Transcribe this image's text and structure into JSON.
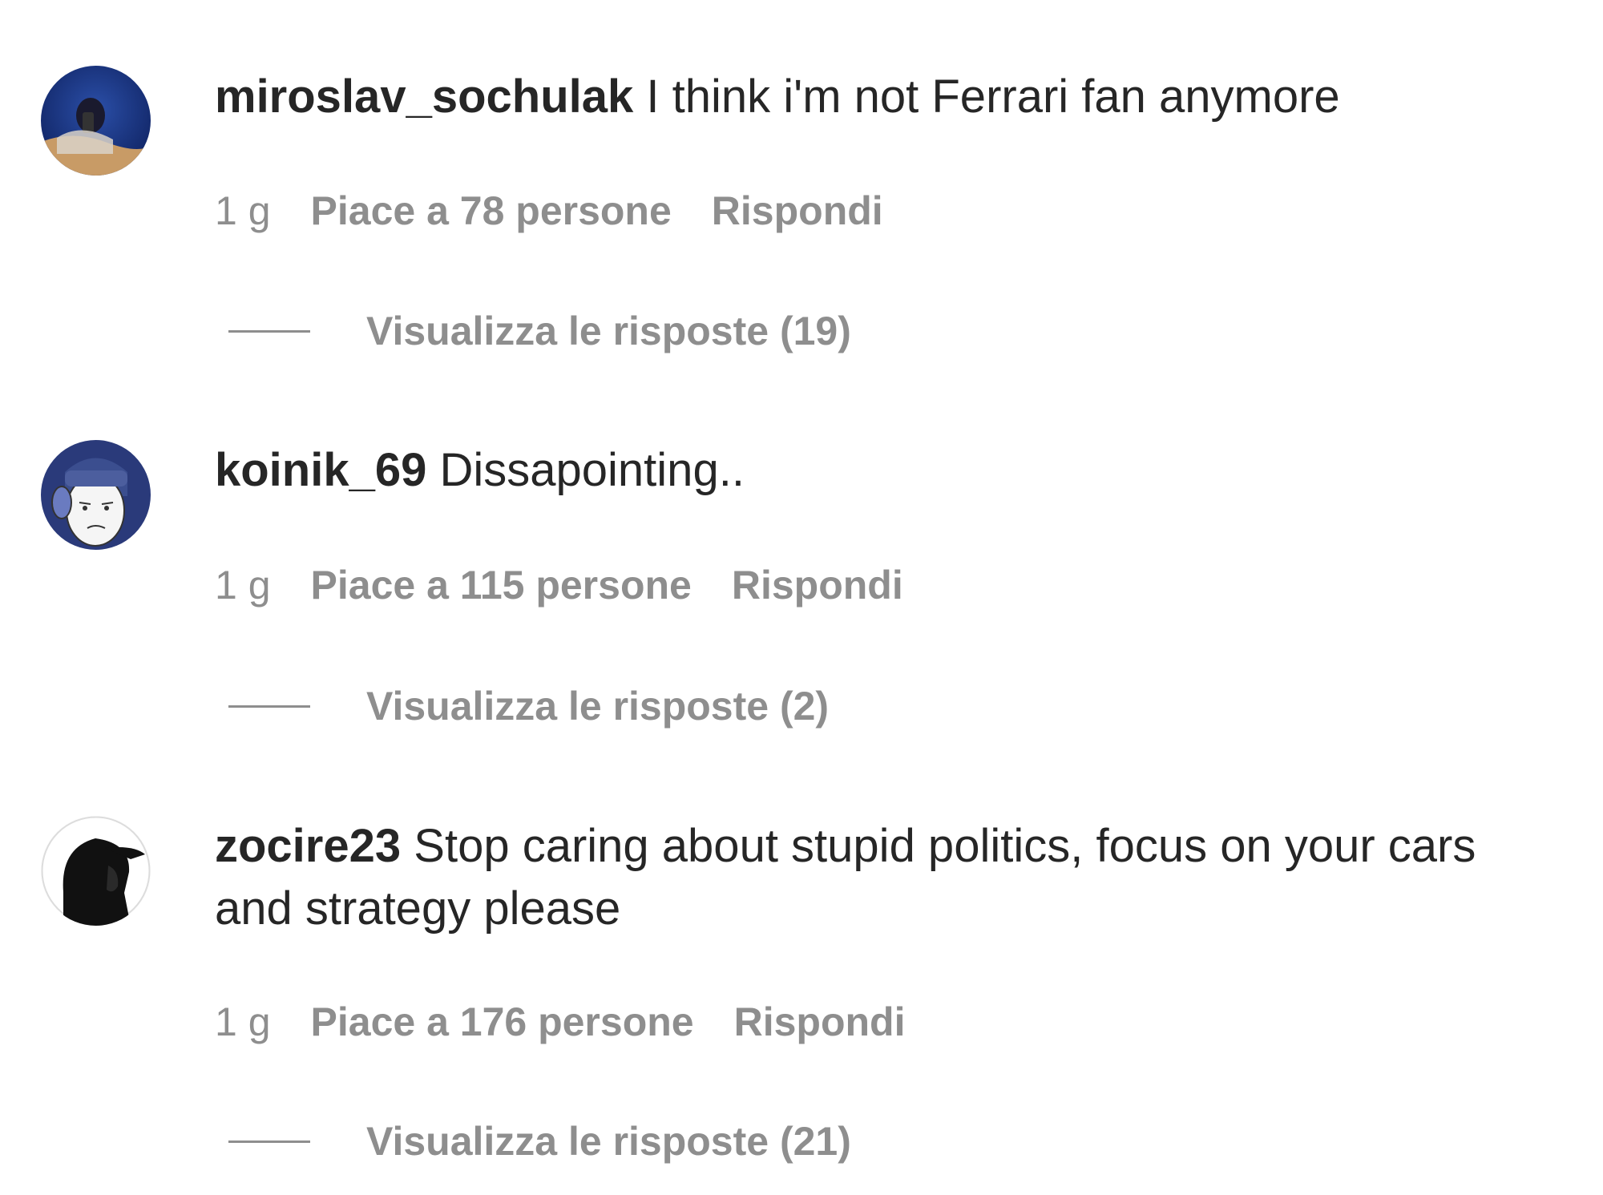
{
  "comments": [
    {
      "username": "miroslav_sochulak",
      "text": "I think i'm not Ferrari fan anymore",
      "time": "1 g",
      "likes": "Piace a 78 persone",
      "reply": "Rispondi",
      "view_replies": "Visualizza le risposte (19)",
      "avatar_icon": "avatar-photo-icon"
    },
    {
      "username": "koinik_69",
      "text": "Dissapointing..",
      "time": "1 g",
      "likes": "Piace a 115 persone",
      "reply": "Rispondi",
      "view_replies": "Visualizza le risposte (2)",
      "avatar_icon": "avatar-cartoon-icon"
    },
    {
      "username": "zocire23",
      "text": "Stop caring about stupid politics, focus on your cars and strategy please",
      "time": "1 g",
      "likes": "Piace a 176 persone",
      "reply": "Rispondi",
      "view_replies": "Visualizza le risposte (21)",
      "avatar_icon": "avatar-silhouette-icon"
    }
  ],
  "colors": {
    "primary_text": "#262626",
    "secondary_text": "#8e8e8e",
    "background": "#ffffff"
  }
}
